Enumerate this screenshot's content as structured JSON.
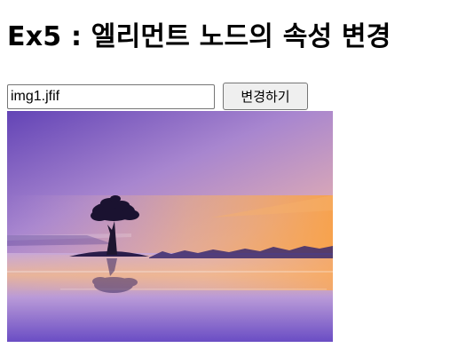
{
  "page": {
    "title": "Ex5 : 엘리먼트 노드의 속성 변경"
  },
  "controls": {
    "input_value": "img1.jfif",
    "button_label": "변경하기"
  },
  "image": {
    "subject": "sunset lake with lone tree",
    "colors": {
      "sky_top": "#6a4cb8",
      "sky_mid": "#b78fcf",
      "horizon_glow": "#f5a65a",
      "water": "#7d64c9"
    }
  }
}
